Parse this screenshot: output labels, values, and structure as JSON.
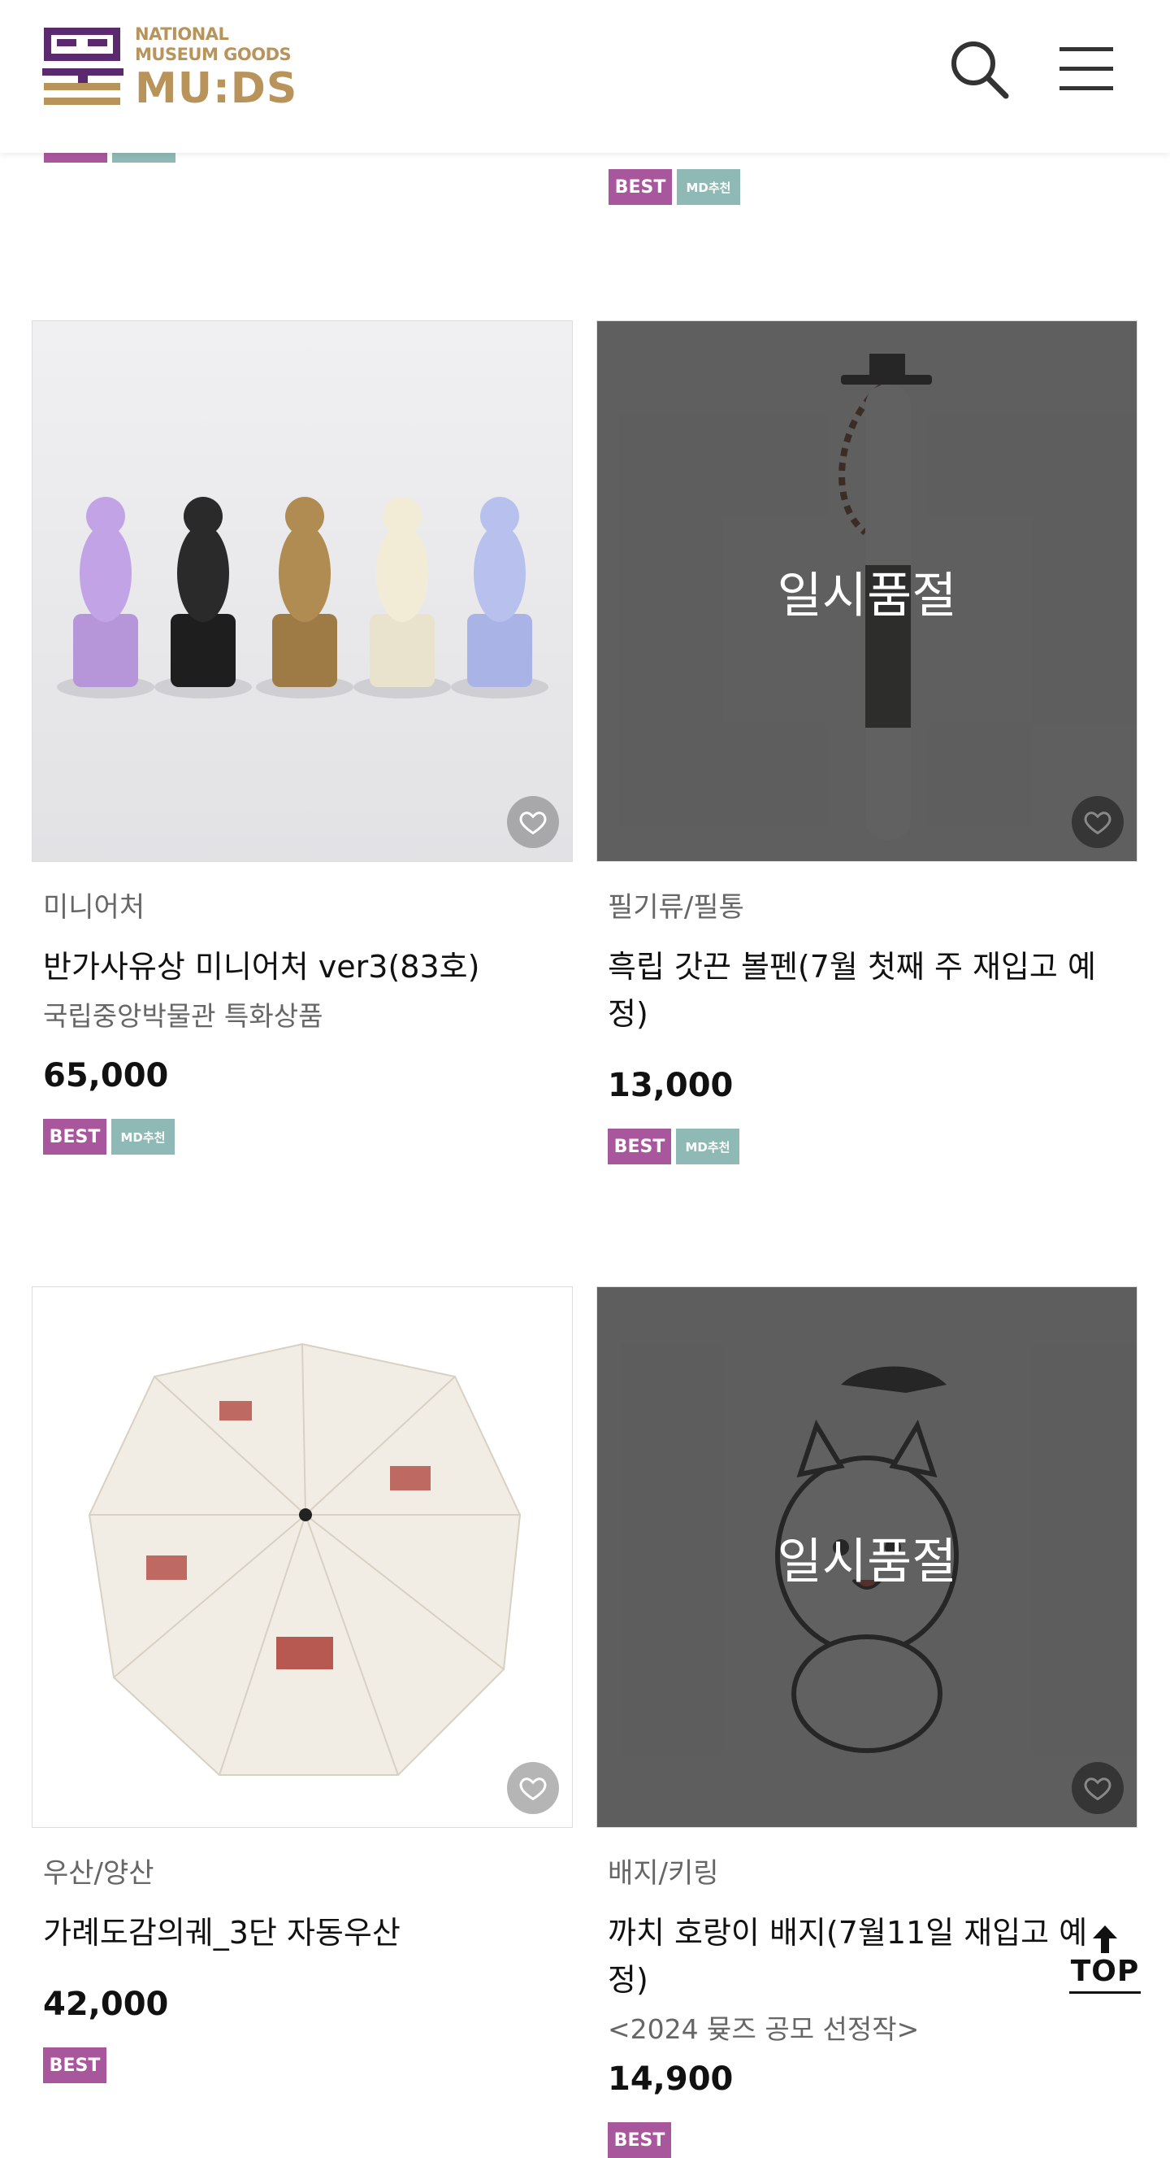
{
  "header": {
    "logo_line1": "NATIONAL",
    "logo_line2": "MUSEUM GOODS",
    "logo_line3": "MU:DS",
    "search_icon": "search-icon",
    "menu_icon": "hamburger-menu-icon"
  },
  "colors": {
    "best_badge": "#a9579d",
    "md_badge": "#8fb9b5",
    "logo_purple": "#5b2a6e",
    "logo_gold": "#b8935a"
  },
  "top_row": {
    "right_badges": [
      "BEST",
      "MD추천"
    ]
  },
  "products": [
    {
      "category": "미니어처",
      "name": "반가사유상 미니어처 ver3(83호)",
      "subtitle": "국립중앙박물관 특화상품",
      "price": "65,000",
      "soldout": false,
      "badges": [
        "BEST",
        "MD추천"
      ]
    },
    {
      "category": "필기류/필통",
      "name": "흑립 갓끈 볼펜(7월 첫째 주 재입고 예정)",
      "soldout_label": "일시품절",
      "price": "13,000",
      "soldout": true,
      "badges": [
        "BEST",
        "MD추천"
      ]
    },
    {
      "category": "우산/양산",
      "name": "가례도감의궤_3단 자동우산",
      "price": "42,000",
      "soldout": false,
      "badges": [
        "BEST"
      ]
    },
    {
      "category": "배지/키링",
      "name": "까치 호랑이 배지(7월11일 재입고 예정)",
      "subtitle": "<2024 뮺즈 공모 선정작>",
      "soldout_label": "일시품절",
      "price": "14,900",
      "soldout": true,
      "badges": [
        "BEST"
      ]
    }
  ],
  "top_button": {
    "label": "TOP",
    "icon": "arrow-up-icon"
  }
}
